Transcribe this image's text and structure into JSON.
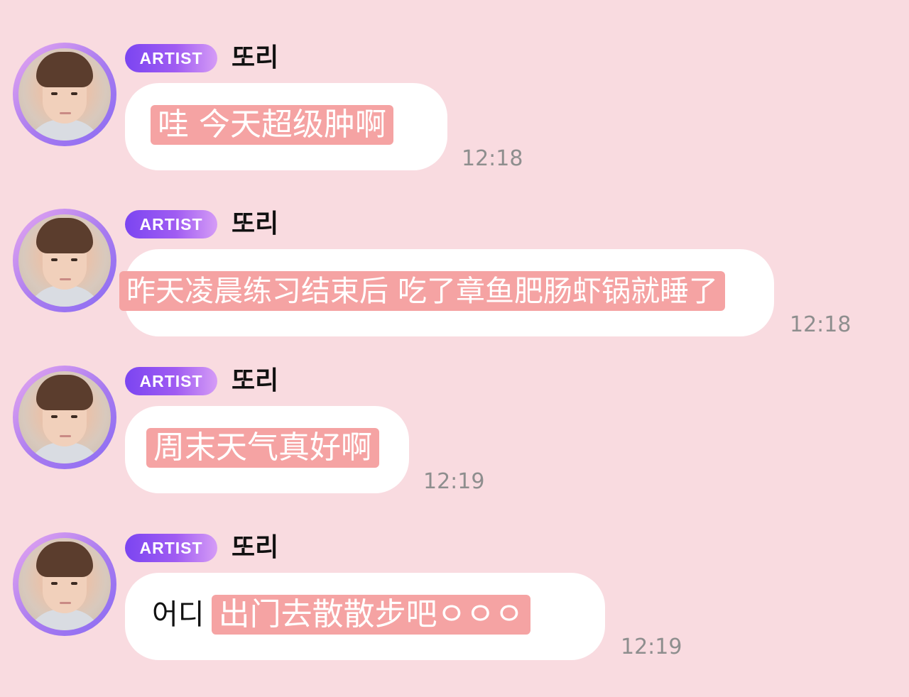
{
  "messages": [
    {
      "badge": "ARTIST",
      "sender": "또리",
      "prefix": "",
      "text": "哇 今天超级肿啊",
      "time": "12:18"
    },
    {
      "badge": "ARTIST",
      "sender": "또리",
      "prefix": "",
      "text": "昨天凌晨练习结束后 吃了章鱼肥肠虾锅就睡了",
      "time": "12:18"
    },
    {
      "badge": "ARTIST",
      "sender": "또리",
      "prefix": "",
      "text": "周末天气真好啊",
      "time": "12:19"
    },
    {
      "badge": "ARTIST",
      "sender": "또리",
      "prefix": "어디",
      "text": "出门去散散步吧ㅇㅇㅇ",
      "time": "12:19"
    }
  ],
  "colors": {
    "background": "#f9dbe0",
    "bubble": "#ffffff",
    "highlight": "#f5a3a3",
    "badge_start": "#7b45f1",
    "badge_end": "#d59cf6",
    "time_text": "#8e8e8e"
  },
  "icons": {
    "avatar": "profile-photo"
  }
}
